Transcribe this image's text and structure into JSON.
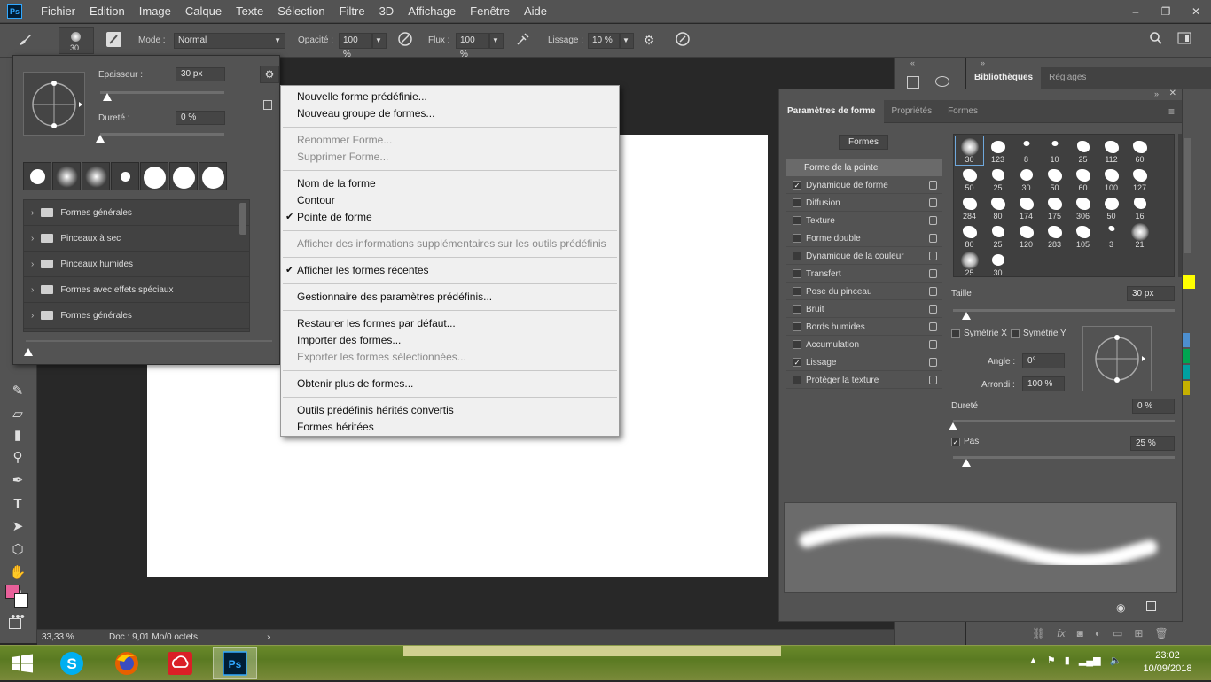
{
  "app": {
    "logo_text": "Ps"
  },
  "menu": [
    "Fichier",
    "Edition",
    "Image",
    "Calque",
    "Texte",
    "Sélection",
    "Filtre",
    "3D",
    "Affichage",
    "Fenêtre",
    "Aide"
  ],
  "window_buttons": [
    "–",
    "❐",
    "✕"
  ],
  "options": {
    "brush_size": "30",
    "mode_label": "Mode :",
    "mode_value": "Normal",
    "opacity_label": "Opacité :",
    "opacity_value": "100 %",
    "flow_label": "Flux :",
    "flow_value": "100 %",
    "smoothing_label": "Lissage :",
    "smoothing_value": "10 %"
  },
  "picker": {
    "size_label": "Epaisseur :",
    "size_value": "30 px",
    "size_level": 0.06,
    "hardness_label": "Dureté :",
    "hardness_value": "0 %",
    "hardness_level": 0,
    "folders": [
      "Formes générales",
      "Pinceaux à sec",
      "Pinceaux humides",
      "Formes avec effets spéciaux",
      "Formes générales"
    ]
  },
  "context_menu": {
    "groups": [
      [
        {
          "label": "Nouvelle forme prédéfinie...",
          "disabled": false,
          "checked": false
        },
        {
          "label": "Nouveau groupe de formes...",
          "disabled": false,
          "checked": false
        }
      ],
      [
        {
          "label": "Renommer Forme...",
          "disabled": true,
          "checked": false
        },
        {
          "label": "Supprimer Forme...",
          "disabled": true,
          "checked": false
        }
      ],
      [
        {
          "label": "Nom de la forme",
          "disabled": false,
          "checked": false
        },
        {
          "label": "Contour",
          "disabled": false,
          "checked": false
        },
        {
          "label": "Pointe de forme",
          "disabled": false,
          "checked": true
        }
      ],
      [
        {
          "label": "Afficher des informations supplémentaires sur les outils prédéfinis",
          "disabled": true,
          "checked": false
        }
      ],
      [
        {
          "label": "Afficher les formes récentes",
          "disabled": false,
          "checked": true
        }
      ],
      [
        {
          "label": "Gestionnaire des paramètres prédéfinis...",
          "disabled": false,
          "checked": false
        }
      ],
      [
        {
          "label": "Restaurer les formes par défaut...",
          "disabled": false,
          "checked": false
        },
        {
          "label": "Importer des formes...",
          "disabled": false,
          "checked": false
        },
        {
          "label": "Exporter les formes sélectionnées...",
          "disabled": true,
          "checked": false
        }
      ],
      [
        {
          "label": "Obtenir plus de formes...",
          "disabled": false,
          "checked": false
        }
      ],
      [
        {
          "label": "Outils prédéfinis hérités convertis",
          "disabled": false,
          "checked": false
        },
        {
          "label": "Formes héritées",
          "disabled": false,
          "checked": false
        }
      ]
    ]
  },
  "library_tabs": [
    "Bibliothèques",
    "Réglages"
  ],
  "brush_panel": {
    "tabs": [
      "Paramètres de forme",
      "Propriétés",
      "Formes"
    ],
    "formes_button": "Formes",
    "section_header": "Forme de la pointe",
    "options": [
      {
        "label": "Dynamique de forme",
        "checked": true
      },
      {
        "label": "Diffusion",
        "checked": false
      },
      {
        "label": "Texture",
        "checked": false
      },
      {
        "label": "Forme double",
        "checked": false
      },
      {
        "label": "Dynamique de la couleur",
        "checked": false
      },
      {
        "label": "Transfert",
        "checked": false
      },
      {
        "label": "Pose du pinceau",
        "checked": false
      },
      {
        "label": "Bruit",
        "checked": false
      },
      {
        "label": "Bords humides",
        "checked": false
      },
      {
        "label": "Accumulation",
        "checked": false
      },
      {
        "label": "Lissage",
        "checked": true
      },
      {
        "label": "Protéger la texture",
        "checked": false
      }
    ],
    "tips": [
      "30",
      "123",
      "8",
      "10",
      "25",
      "112",
      "60",
      "50",
      "25",
      "30",
      "50",
      "60",
      "100",
      "127",
      "284",
      "80",
      "174",
      "175",
      "306",
      "50",
      "16",
      "80",
      "25",
      "120",
      "283",
      "105",
      "3",
      "21",
      "25",
      "30"
    ],
    "size_label": "Taille",
    "size_value": "30 px",
    "size_level": 0.06,
    "flip_x": "Symétrie X",
    "flip_y": "Symétrie Y",
    "angle_label": "Angle :",
    "angle_value": "0°",
    "roundness_label": "Arrondi :",
    "roundness_value": "100 %",
    "hardness_label": "Dureté",
    "hardness_value": "0 %",
    "hardness_level": 0,
    "spacing_label": "Pas",
    "spacing_value": "25 %",
    "spacing_level": 0.06
  },
  "status": {
    "zoom": "33,33 %",
    "doc": "Doc : 9,01 Mo/0 octets"
  },
  "taskbar": {
    "time": "23:02",
    "date": "10/09/2018"
  },
  "colors": {
    "foreground": "#e8609a",
    "background": "#ffffff",
    "accent": "#31a8ff"
  }
}
